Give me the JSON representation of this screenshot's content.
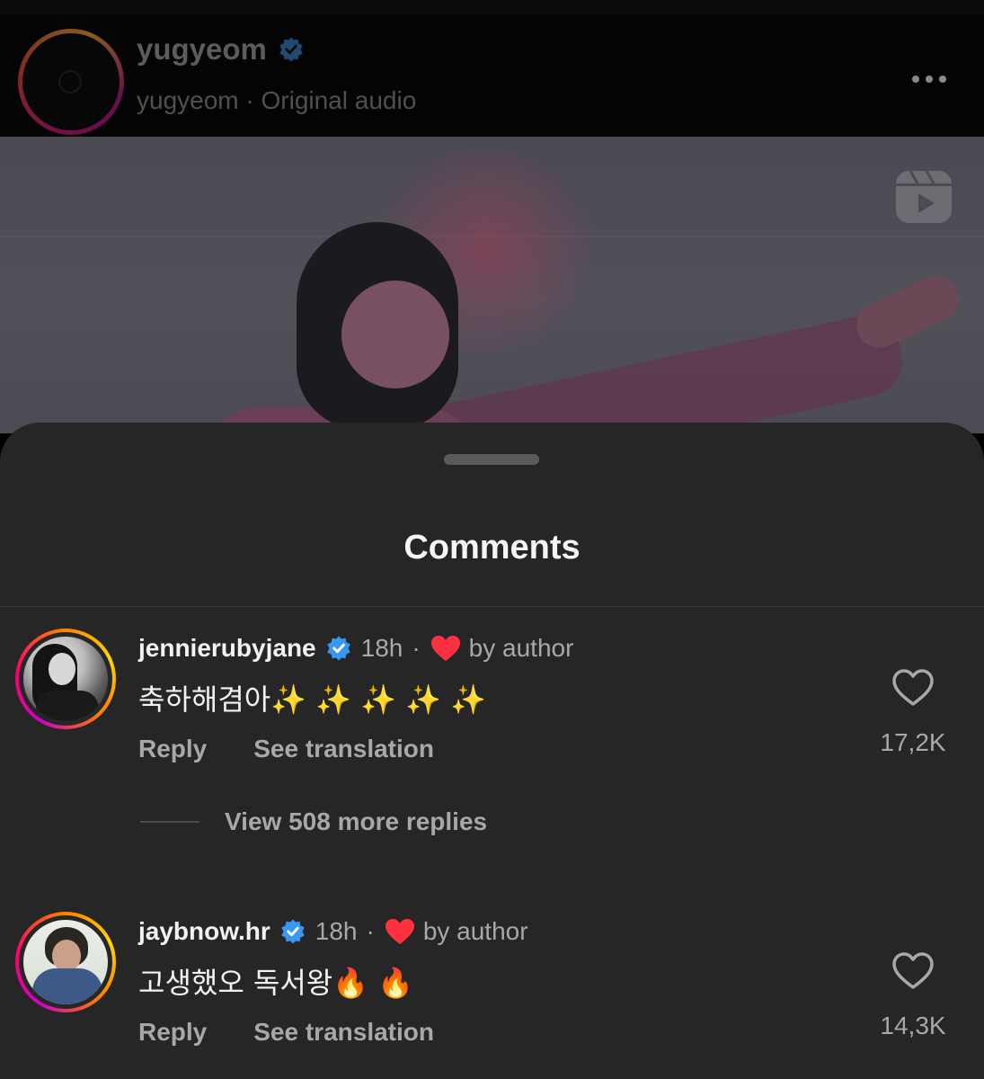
{
  "header": {
    "channel_name": "yugyeom",
    "subtitle": "yugyeom · Original audio"
  },
  "sheet": {
    "title": "Comments"
  },
  "comments": [
    {
      "username": "jennierubyjane",
      "time": "18h",
      "separator": "·",
      "liked_by": "by author",
      "text": "축하해겸아✨ ✨ ✨ ✨ ✨",
      "likes": "17,2K",
      "reply_label": "Reply",
      "translate_label": "See translation",
      "view_replies": "View 508 more replies"
    },
    {
      "username": "jaybnow.hr",
      "time": "18h",
      "separator": "·",
      "liked_by": "by author",
      "text": "고생했오 독서왕🔥 🔥",
      "likes": "14,3K",
      "reply_label": "Reply",
      "translate_label": "See translation"
    }
  ],
  "colors": {
    "sheet_bg": "#262626",
    "verified_blue": "#3897f0",
    "heart_red": "#ff3040",
    "text_primary": "#f2f2f2",
    "text_secondary": "#a8a8a8"
  },
  "icons": {
    "verified": "verified-badge-icon",
    "more": "more-horizontal-icon",
    "reels": "reels-icon",
    "like": "heart-outline-icon",
    "author_liked": "heart-filled-icon"
  }
}
